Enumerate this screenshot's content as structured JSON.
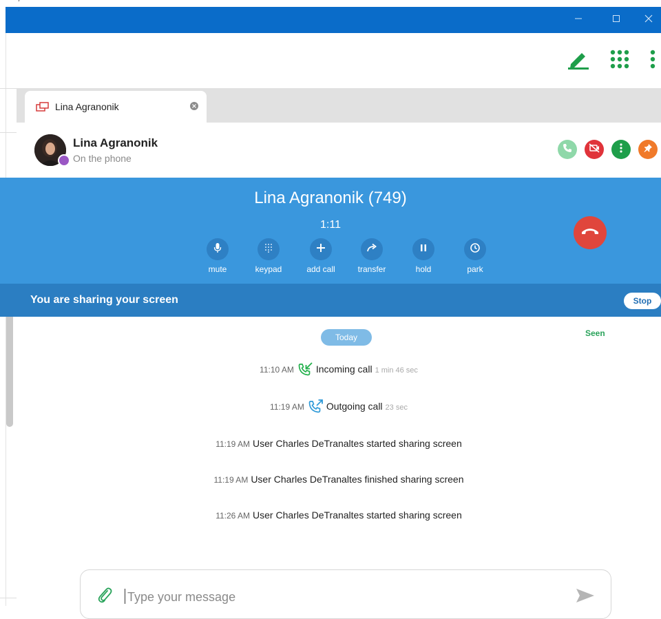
{
  "window": {
    "top_text": "— · / · ·· ··· ·· ···· ·· ··",
    "controls": [
      "minimize-icon",
      "maximize-icon",
      "close-icon"
    ],
    "titlebar_color": "#0a6cc9"
  },
  "toolbar": {
    "icons": [
      "compose-icon",
      "apps-grid-icon",
      "more-vertical-icon"
    ],
    "accent_color": "#1e9e4a"
  },
  "tab": {
    "label": "Lina Agranonik",
    "icon": "screen-share-icon"
  },
  "contact": {
    "name": "Lina Agranonik",
    "status": "On the phone",
    "actions": [
      "call-icon",
      "video-off-icon",
      "more-icon",
      "pin-icon"
    ]
  },
  "call": {
    "title": "Lina Agranonik (749)",
    "timer": "1:11",
    "controls": [
      {
        "label": "mute",
        "icon": "microphone-icon"
      },
      {
        "label": "keypad",
        "icon": "keypad-icon"
      },
      {
        "label": "add call",
        "icon": "plus-icon"
      },
      {
        "label": "transfer",
        "icon": "transfer-arrow-icon"
      },
      {
        "label": "hold",
        "icon": "pause-icon"
      },
      {
        "label": "park",
        "icon": "clock-icon"
      }
    ],
    "panel_color": "#3a97dd",
    "hangup_color": "#e0463c"
  },
  "share_banner": {
    "text": "You are sharing your screen",
    "stop_label": "Stop"
  },
  "chat": {
    "date_label": "Today",
    "seen_label": "Seen",
    "messages": [
      {
        "time": "11:10 AM",
        "text": "Incoming call",
        "duration": "1 min 46 sec",
        "icon": "incoming-call-icon"
      },
      {
        "time": "11:19 AM",
        "text": "Outgoing call",
        "duration": "23 sec",
        "icon": "outgoing-call-icon"
      },
      {
        "time": "11:19 AM",
        "text": "User Charles DeTranaltes started sharing screen"
      },
      {
        "time": "11:19 AM",
        "text": "User Charles DeTranaltes finished sharing screen"
      },
      {
        "time": "11:26 AM",
        "text": "User Charles DeTranaltes started sharing screen"
      }
    ]
  },
  "composer": {
    "placeholder": "Type your message",
    "value": ""
  }
}
